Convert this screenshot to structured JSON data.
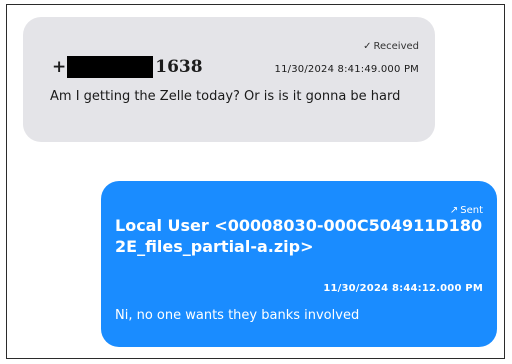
{
  "messages": {
    "received": {
      "status": "Received",
      "sender_prefix": "+",
      "sender_suffix": "1638",
      "timestamp": "11/30/2024 8:41:49.000 PM",
      "text": "Am I getting the Zelle today? Or is is it gonna be hard"
    },
    "sent": {
      "status": "Sent",
      "user": "Local User <00008030-000C504911D1802E_files_partial-a.zip>",
      "timestamp": "11/30/2024 8:44:12.000 PM",
      "text": "Ni, no one wants they banks involved"
    }
  },
  "colors": {
    "received_bubble": "#e4e4e8",
    "sent_bubble": "#1a8cff",
    "redaction": "#000000"
  },
  "icons": {
    "received_status": "check-icon",
    "sent_status": "send-arrow-icon"
  }
}
